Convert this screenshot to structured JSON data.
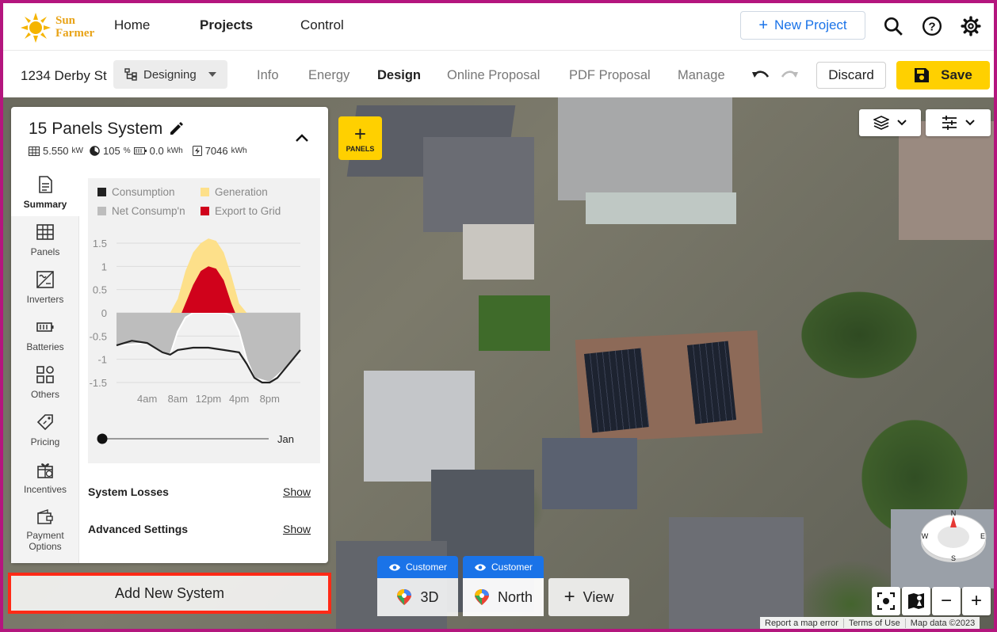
{
  "brand": {
    "line1": "Sun",
    "line2": "Farmer",
    "color": "#e8a317"
  },
  "nav": {
    "home": "Home",
    "projects": "Projects",
    "control": "Control",
    "new_project": "New Project",
    "icons": [
      "search-icon",
      "help-icon",
      "gear-icon"
    ]
  },
  "subnav": {
    "address": "1234 Derby St",
    "status": "Designing",
    "tabs": [
      "Info",
      "Energy",
      "Design",
      "Online Proposal",
      "PDF Proposal",
      "Manage"
    ],
    "active_tab": "Design",
    "discard": "Discard",
    "save": "Save"
  },
  "system": {
    "title": "15 Panels System",
    "power": "5.550",
    "power_unit": "kW",
    "offset": "105",
    "offset_unit": "%",
    "battery": "0.0",
    "battery_unit": "kWh",
    "annual": "7046",
    "annual_unit": "kWh"
  },
  "sidetabs": [
    {
      "label": "Summary",
      "icon": "document-icon",
      "active": true
    },
    {
      "label": "Panels",
      "icon": "panel-grid-icon"
    },
    {
      "label": "Inverters",
      "icon": "inverter-icon"
    },
    {
      "label": "Batteries",
      "icon": "battery-icon"
    },
    {
      "label": "Others",
      "icon": "others-grid-icon"
    },
    {
      "label": "Pricing",
      "icon": "price-tag-icon"
    },
    {
      "label": "Incentives",
      "icon": "gift-icon"
    },
    {
      "label": "Payment",
      "label2": "Options",
      "icon": "wallet-icon"
    }
  ],
  "chart_data": {
    "type": "area",
    "legend": [
      "Consumption",
      "Generation",
      "Net Consump'n",
      "Export to Grid"
    ],
    "colors": {
      "Consumption": "#222222",
      "Generation": "#fde08a",
      "Net Consump'n": "#bdbdbd",
      "Export to Grid": "#d0021b"
    },
    "y_ticks": [
      "1.5",
      "1",
      "0.5",
      "0",
      "-0.5",
      "-1",
      "-1.5"
    ],
    "x_ticks": [
      "4am",
      "8am",
      "12pm",
      "4pm",
      "8pm"
    ],
    "ylim": [
      -1.5,
      1.5
    ],
    "month": "Jan",
    "month_slider_value": 0,
    "series": [
      {
        "name": "Generation",
        "x": [
          7,
          8,
          9,
          10,
          11,
          12,
          13,
          14,
          15,
          16,
          17
        ],
        "values": [
          0,
          0.3,
          0.9,
          1.3,
          1.5,
          1.6,
          1.55,
          1.3,
          0.8,
          0.2,
          0
        ]
      },
      {
        "name": "Export to Grid",
        "x": [
          8.5,
          9,
          10,
          11,
          12,
          13,
          14,
          15,
          15.5
        ],
        "values": [
          0,
          0.2,
          0.6,
          0.9,
          1.0,
          0.95,
          0.7,
          0.2,
          0
        ]
      },
      {
        "name": "Consumption",
        "x": [
          0,
          2,
          4,
          6,
          7,
          8,
          10,
          12,
          14,
          16,
          17,
          18,
          19,
          20,
          21,
          22,
          24
        ],
        "values": [
          -0.7,
          -0.6,
          -0.65,
          -0.85,
          -0.9,
          -0.8,
          -0.75,
          -0.75,
          -0.8,
          -0.85,
          -1.1,
          -1.4,
          -1.5,
          -1.5,
          -1.4,
          -1.2,
          -0.8
        ]
      },
      {
        "name": "Net Consump'n",
        "x": [
          0,
          4,
          6,
          7,
          8,
          9,
          10,
          11,
          12,
          13,
          14,
          15,
          16,
          17,
          18,
          20,
          22,
          24
        ],
        "values": [
          -0.7,
          -0.65,
          -0.85,
          -0.9,
          -0.4,
          -0.1,
          0,
          0,
          0,
          0,
          0,
          -0.05,
          -0.4,
          -1.0,
          -1.4,
          -1.5,
          -1.2,
          -0.8
        ]
      }
    ]
  },
  "losses": {
    "label": "System Losses",
    "show": "Show"
  },
  "advanced": {
    "label": "Advanced Settings",
    "show": "Show"
  },
  "add_system": "Add New System",
  "panels_btn": {
    "plus": "+",
    "label": "PANELS"
  },
  "views": [
    {
      "tag": "Customer",
      "label": "3D"
    },
    {
      "tag": "Customer",
      "label": "North"
    }
  ],
  "view_add": "View",
  "compass": {
    "n": "N",
    "e": "E",
    "s": "S",
    "w": "W"
  },
  "zoom": {
    "minus": "−",
    "plus": "+"
  },
  "attribution": [
    "Report a map error",
    "Terms of Use",
    "Map data ©2023"
  ]
}
